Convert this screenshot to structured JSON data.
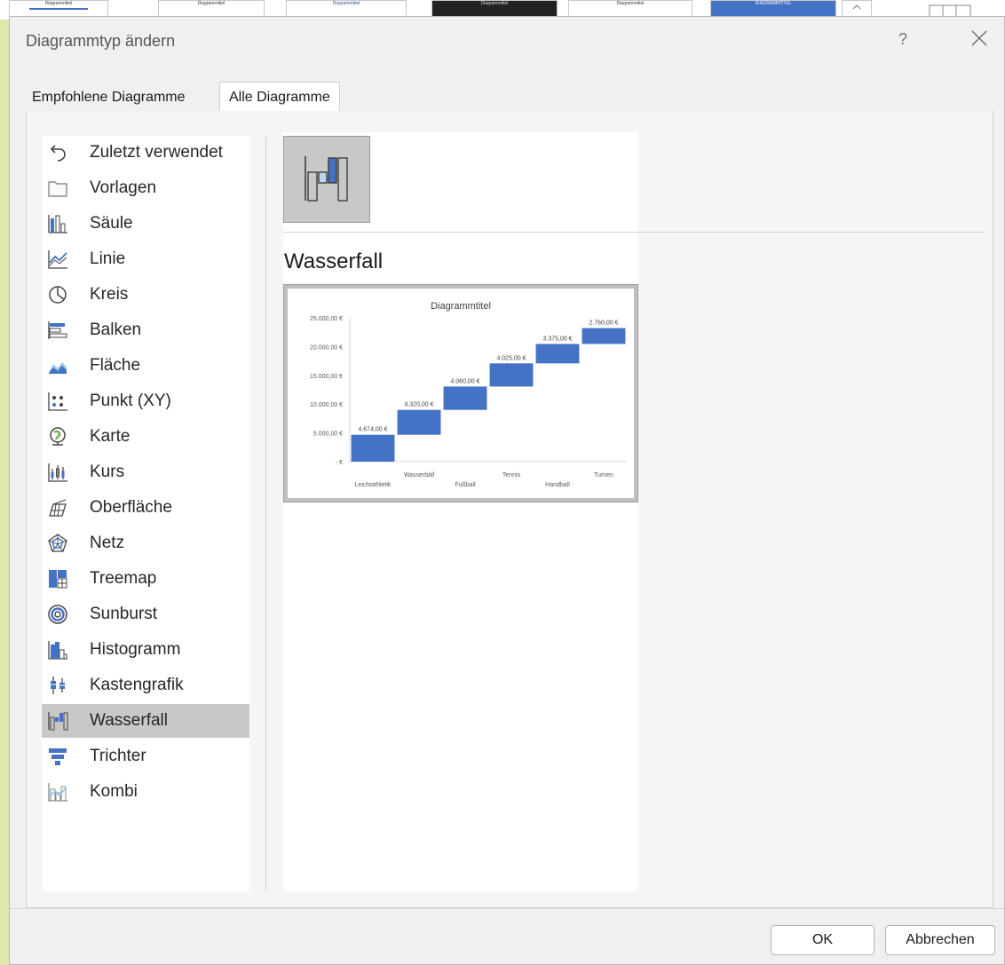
{
  "background_ribbon": {
    "thumbnails": [
      "Diagrammtitel",
      "Diagrammtitel",
      "Diagrammtitel",
      "Diagrammtitel",
      "Diagrammtitel",
      "DIAGRAMMTITEL"
    ]
  },
  "dialog": {
    "title": "Diagrammtyp ändern",
    "help": "?",
    "tabs": [
      {
        "label": "Empfohlene Diagramme",
        "active": false
      },
      {
        "label": "Alle Diagramme",
        "active": true
      }
    ],
    "chart_types": [
      {
        "label": "Zuletzt verwendet",
        "icon": "undo-icon"
      },
      {
        "label": "Vorlagen",
        "icon": "folder-icon"
      },
      {
        "label": "Säule",
        "icon": "column-chart-icon"
      },
      {
        "label": "Linie",
        "icon": "line-chart-icon"
      },
      {
        "label": "Kreis",
        "icon": "pie-chart-icon"
      },
      {
        "label": "Balken",
        "icon": "bar-chart-icon"
      },
      {
        "label": "Fläche",
        "icon": "area-chart-icon"
      },
      {
        "label": "Punkt (XY)",
        "icon": "scatter-chart-icon"
      },
      {
        "label": "Karte",
        "icon": "map-chart-icon"
      },
      {
        "label": "Kurs",
        "icon": "stock-chart-icon"
      },
      {
        "label": "Oberfläche",
        "icon": "surface-chart-icon"
      },
      {
        "label": "Netz",
        "icon": "radar-chart-icon"
      },
      {
        "label": "Treemap",
        "icon": "treemap-icon"
      },
      {
        "label": "Sunburst",
        "icon": "sunburst-icon"
      },
      {
        "label": "Histogramm",
        "icon": "histogram-icon"
      },
      {
        "label": "Kastengrafik",
        "icon": "box-whisker-icon"
      },
      {
        "label": "Wasserfall",
        "icon": "waterfall-icon",
        "selected": true
      },
      {
        "label": "Trichter",
        "icon": "funnel-icon"
      },
      {
        "label": "Kombi",
        "icon": "combo-chart-icon"
      }
    ],
    "subtype_heading": "Wasserfall",
    "ok_label": "OK",
    "cancel_label": "Abbrechen"
  },
  "colors": {
    "accent": "#4472c4",
    "selection": "#c8c8c8"
  },
  "chart_data": {
    "type": "bar",
    "subtype": "waterfall",
    "title": "Diagrammtitel",
    "categories": [
      "Leichtathletik",
      "Wasserball",
      "Fußball",
      "Tennis",
      "Handball",
      "Turnen"
    ],
    "values": [
      4674,
      4320,
      4060,
      4025,
      3375,
      2760
    ],
    "data_labels": [
      "4.674,00 €",
      "4.320,00 €",
      "4.060,00 €",
      "4.025,00 €",
      "3.375,00 €",
      "2.760,00 €"
    ],
    "y_ticks": [
      "-   €",
      "5.000,00 €",
      "10.000,00 €",
      "15.000,00 €",
      "20.000,00 €",
      "25.000,00 €"
    ],
    "ylim": [
      0,
      25000
    ],
    "grid": false,
    "color": "#4472c4"
  }
}
